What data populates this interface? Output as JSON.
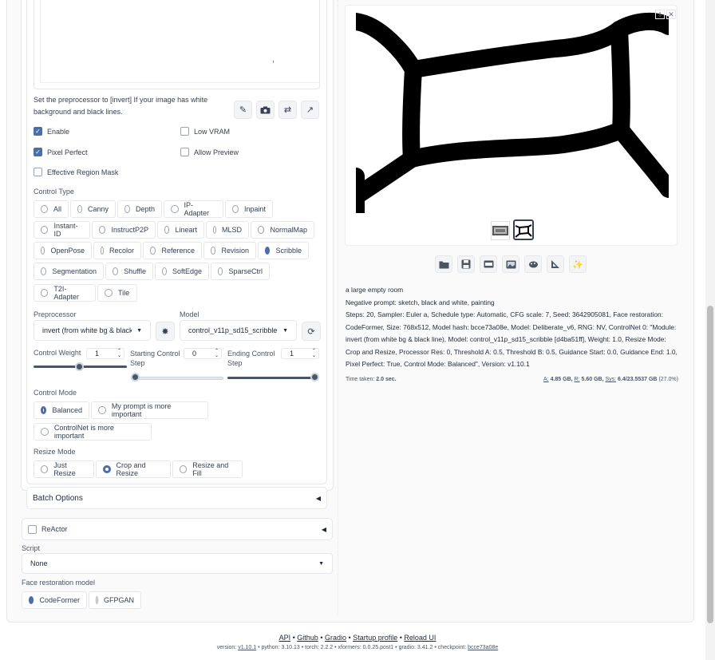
{
  "controlnet": {
    "hint": "Set the preprocessor to [invert] If your image has white background and black lines.",
    "tool_icons": [
      "pencil-icon",
      "camera-icon",
      "swap-icon",
      "send-icon"
    ],
    "checkboxes": {
      "enable": "Enable",
      "low_vram": "Low VRAM",
      "pixel_perfect": "Pixel Perfect",
      "allow_preview": "Allow Preview",
      "effective_region_mask": "Effective Region Mask"
    },
    "checked": {
      "enable": true,
      "low_vram": false,
      "pixel_perfect": true,
      "allow_preview": false,
      "effective_region_mask": false
    },
    "control_type_label": "Control Type",
    "control_types": [
      "All",
      "Canny",
      "Depth",
      "IP-Adapter",
      "Inpaint",
      "Instant-ID",
      "InstructP2P",
      "Lineart",
      "MLSD",
      "NormalMap",
      "OpenPose",
      "Recolor",
      "Reference",
      "Revision",
      "Scribble",
      "Segmentation",
      "Shuffle",
      "SoftEdge",
      "SparseCtrl",
      "T2I-Adapter",
      "Tile"
    ],
    "control_type_selected": "Scribble",
    "preprocessor_label": "Preprocessor",
    "preprocessor_value": "invert (from white bg & black",
    "model_label": "Model",
    "model_value": "control_v11p_sd15_scribble",
    "control_weight_label": "Control Weight",
    "control_weight_value": "1",
    "control_weight": 1,
    "starting_step_label": "Starting Control Step",
    "starting_step_value": "0",
    "starting_step": 0,
    "ending_step_label": "Ending Control Step",
    "ending_step_value": "1",
    "ending_step": 1,
    "control_mode_label": "Control Mode",
    "control_modes": [
      "Balanced",
      "My prompt is more important",
      "ControlNet is more important"
    ],
    "control_mode_selected": "Balanced",
    "resize_mode_label": "Resize Mode",
    "resize_modes": [
      "Just Resize",
      "Crop and Resize",
      "Resize and Fill"
    ],
    "resize_mode_selected": "Crop and Resize"
  },
  "batch_options": {
    "label": "Batch Options"
  },
  "reactor": {
    "label": "ReActor",
    "checked": false
  },
  "script": {
    "label": "Script",
    "value": "None"
  },
  "face_restoration": {
    "label": "Face restoration model",
    "options": [
      "CodeFormer",
      "GFPGAN"
    ],
    "selected": "CodeFormer"
  },
  "output": {
    "action_icons": [
      "folder-icon",
      "save-icon",
      "zip-icon",
      "img2img-icon",
      "inpaint-icon",
      "extras-icon",
      "sparkle-icon"
    ],
    "prompt": "a large empty room",
    "negative": "Negative prompt: sketch, black and white, painting",
    "params": "Steps: 20, Sampler: Euler a, Schedule type: Automatic, CFG scale: 7, Seed: 3642905081, Face restoration: CodeFormer, Size: 768x512, Model hash: bcce73a08e, Model: Deliberate_v6, RNG: NV, ControlNet 0: \"Module: invert (from white bg & black line), Model: control_v11p_sd15_scribble [d4ba51ff], Weight: 1.0, Resize Mode: Crop and Resize, Processor Res: 0, Threshold A: 0.5, Threshold B: 0.5, Guidance Start: 0.0, Guidance End: 1.0, Pixel Perfect: True, Control Mode: Balanced\", Version: v1.10.1",
    "time_label": "Time taken:",
    "time_value": "2.0 sec.",
    "mem_a_label": "A:",
    "mem_a": "4.85 GB,",
    "mem_r_label": "R:",
    "mem_r": "5.60 GB,",
    "mem_sys_label": "Sys:",
    "mem_sys": "6.4/23.5537 GB",
    "mem_pct": "(27.0%)"
  },
  "footer": {
    "links": [
      "API",
      "Github",
      "Gradio",
      "Startup profile",
      "Reload UI"
    ],
    "separator": "•",
    "version_label": "version:",
    "version": "v1.10.1",
    "python": "python: 3.10.13",
    "torch": "torch: 2.2.2",
    "xformers": "xformers: 0.0.25.post1",
    "gradio": "gradio: 3.41.2",
    "checkpoint_label": "checkpoint:",
    "checkpoint": "bcce73a08e"
  }
}
